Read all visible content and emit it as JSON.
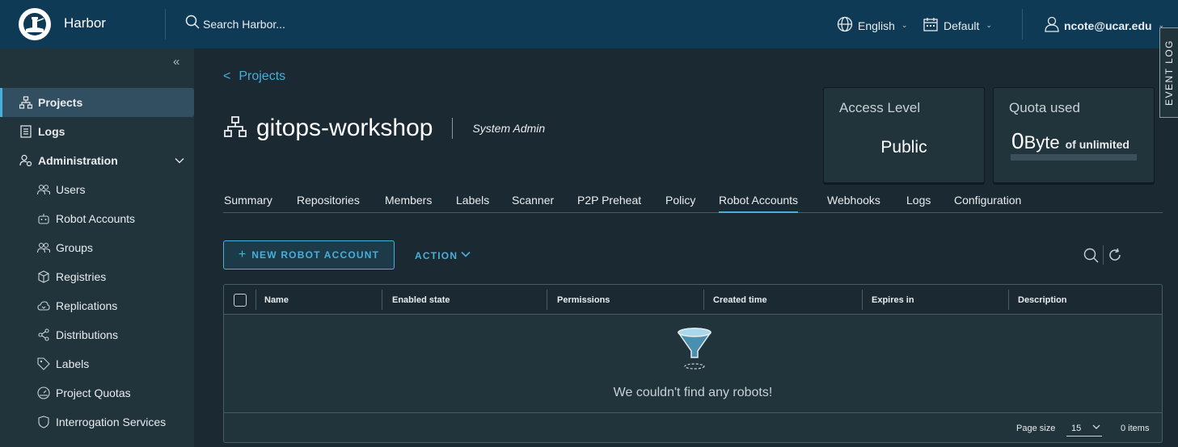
{
  "header": {
    "brand": "Harbor",
    "search_placeholder": "Search Harbor...",
    "language": "English",
    "theme": "Default",
    "user": "ncote@ucar.edu",
    "event_log": "EVENT LOG"
  },
  "sidebar": {
    "items": [
      {
        "label": "Projects",
        "icon": "projects-icon"
      },
      {
        "label": "Logs",
        "icon": "logs-icon"
      },
      {
        "label": "Administration",
        "icon": "administration-icon"
      },
      {
        "label": "Users",
        "icon": "users-icon"
      },
      {
        "label": "Robot Accounts",
        "icon": "robot-icon"
      },
      {
        "label": "Groups",
        "icon": "groups-icon"
      },
      {
        "label": "Registries",
        "icon": "registries-icon"
      },
      {
        "label": "Replications",
        "icon": "replications-icon"
      },
      {
        "label": "Distributions",
        "icon": "distributions-icon"
      },
      {
        "label": "Labels",
        "icon": "labels-icon"
      },
      {
        "label": "Project Quotas",
        "icon": "quotas-icon"
      },
      {
        "label": "Interrogation Services",
        "icon": "shield-icon"
      }
    ]
  },
  "breadcrumb": {
    "label": "Projects"
  },
  "project": {
    "name": "gitops-workshop",
    "role": "System Admin"
  },
  "cards": {
    "access_title": "Access Level",
    "access_value": "Public",
    "quota_title": "Quota used",
    "quota_number": "0",
    "quota_unit": "Byte",
    "quota_of": "of unlimited"
  },
  "tabs": [
    "Summary",
    "Repositories",
    "Members",
    "Labels",
    "Scanner",
    "P2P Preheat",
    "Policy",
    "Robot Accounts",
    "Webhooks",
    "Logs",
    "Configuration"
  ],
  "toolbar": {
    "new_label": "NEW ROBOT ACCOUNT",
    "action_label": "ACTION"
  },
  "grid": {
    "columns": [
      "Name",
      "Enabled state",
      "Permissions",
      "Created time",
      "Expires in",
      "Description"
    ],
    "empty_message": "We couldn't find any robots!",
    "page_size_label": "Page size",
    "page_size": "15",
    "item_count": "0 items"
  },
  "colors": {
    "accent": "#49aeda",
    "header": "#0f3a55",
    "sidebar": "#21333b",
    "background": "#1b2a32"
  }
}
